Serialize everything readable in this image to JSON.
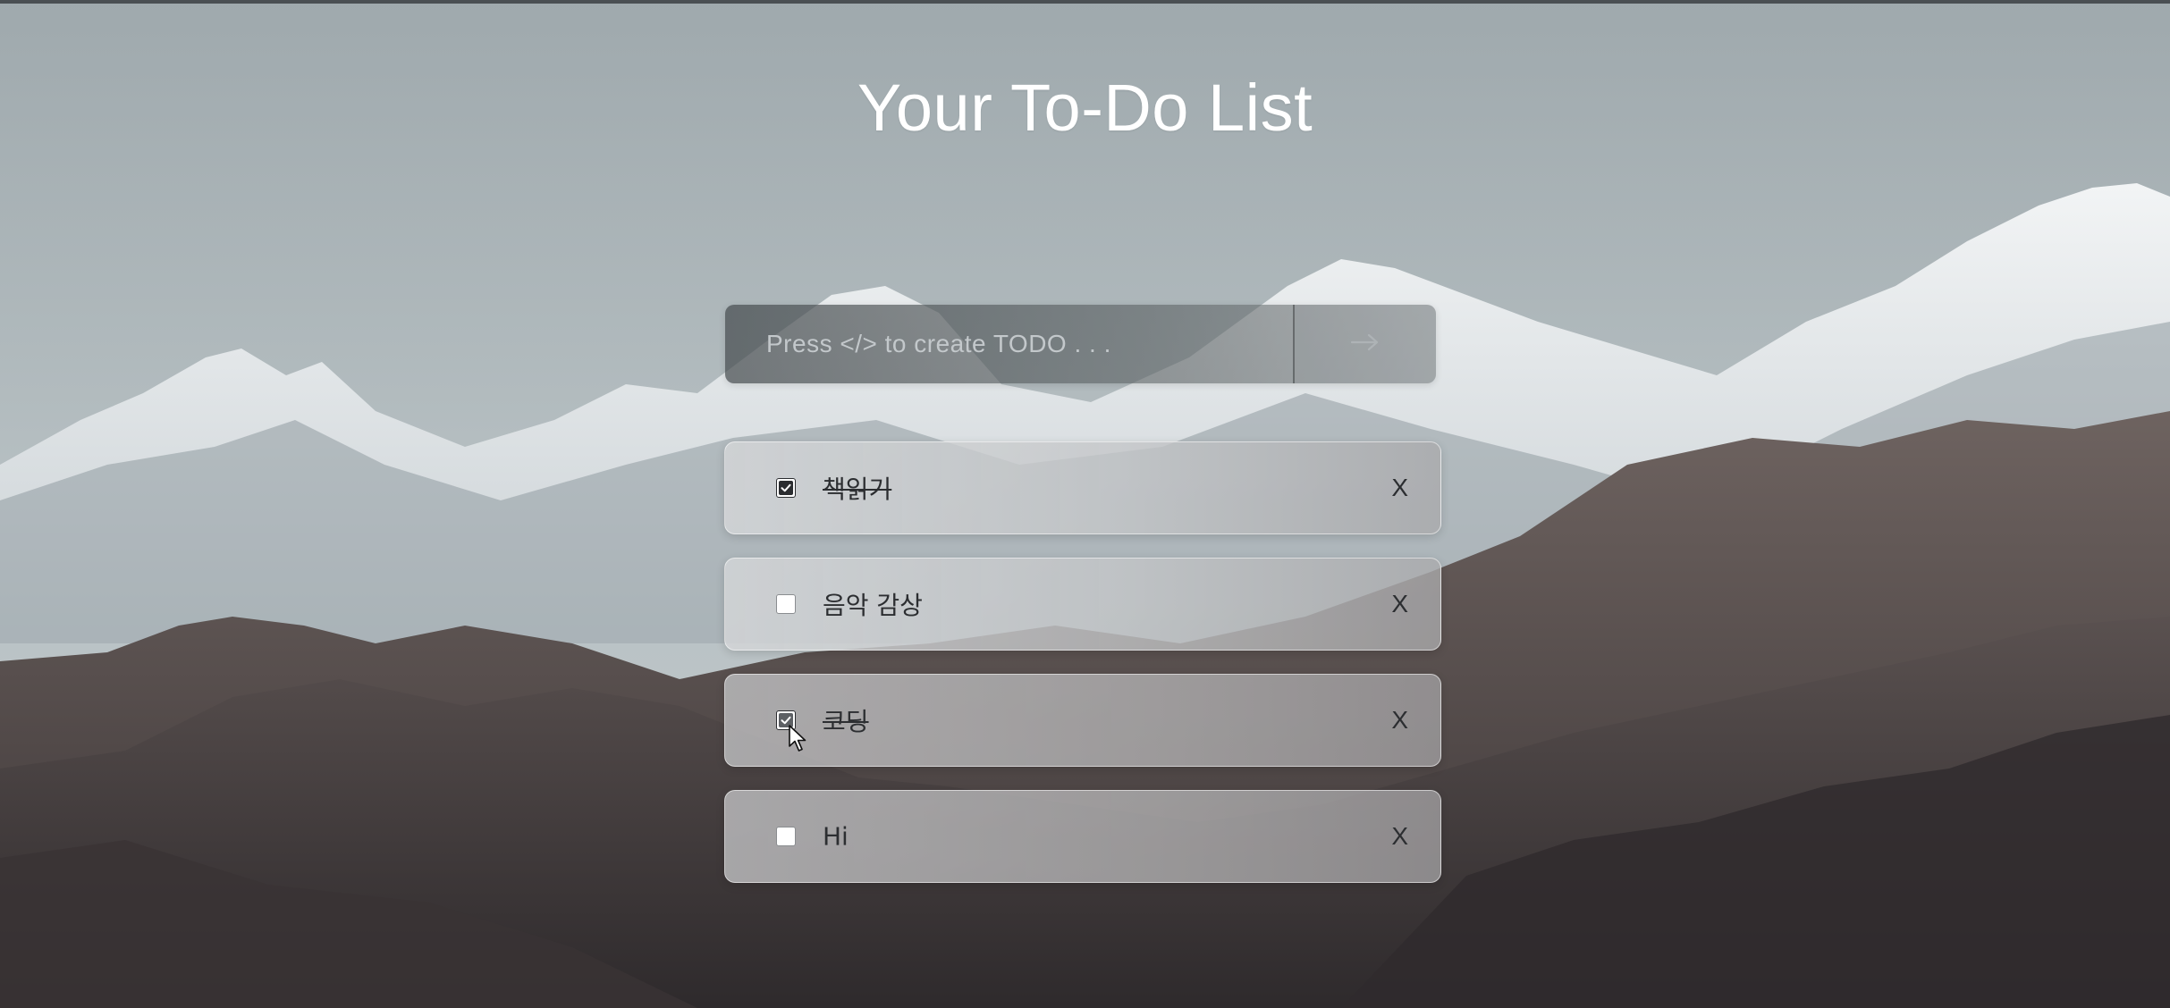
{
  "app": {
    "title": "Your To-Do List"
  },
  "input": {
    "placeholder": "Press </> to create TODO . . .",
    "value": "",
    "submit_icon": "arrow-right-icon"
  },
  "todos": [
    {
      "label": "책읽기",
      "checked": true,
      "delete_label": "X"
    },
    {
      "label": "음악 감상",
      "checked": false,
      "delete_label": "X"
    },
    {
      "label": "코딩",
      "checked": true,
      "delete_label": "X"
    },
    {
      "label": "Hi",
      "checked": false,
      "delete_label": "X"
    }
  ],
  "colors": {
    "title": "#ffffff",
    "item_text": "#2c2e31",
    "input_bg": "#4e5457"
  }
}
